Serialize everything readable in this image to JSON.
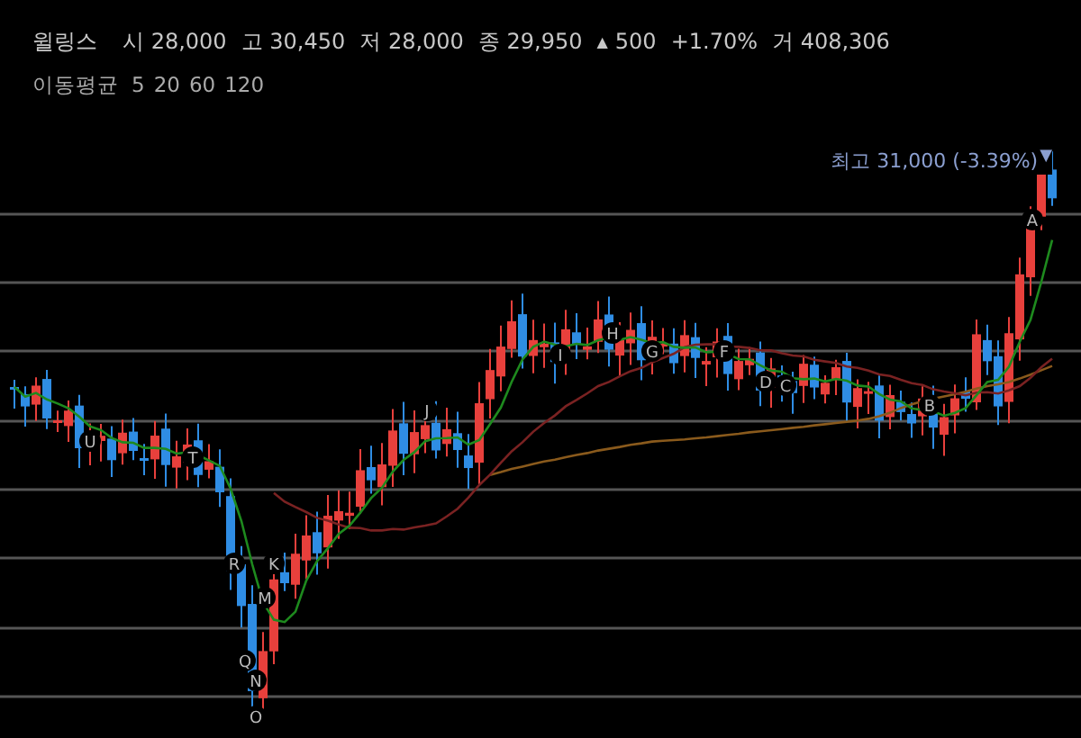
{
  "quote": {
    "name": "윌링스",
    "fields": [
      {
        "label": "시",
        "value": "28,000"
      },
      {
        "label": "고",
        "value": "30,450"
      },
      {
        "label": "저",
        "value": "28,000"
      },
      {
        "label": "종",
        "value": "29,950"
      }
    ],
    "change": {
      "arrow": "▲",
      "amount": "500",
      "percent": "+1.70%"
    },
    "volume": {
      "label": "거",
      "value": "408,306"
    }
  },
  "legend": {
    "title": "이동평균",
    "periods": [
      "5",
      "20",
      "60",
      "120"
    ]
  },
  "chart": {
    "high_label": "최고 31,000 (-3.39%)",
    "high_marker": "▼",
    "markers": [
      "U",
      "T",
      "R",
      "Q",
      "N",
      "O",
      "M",
      "K",
      "J",
      "I",
      "H",
      "G",
      "F",
      "D",
      "C",
      "B",
      "A"
    ]
  }
}
